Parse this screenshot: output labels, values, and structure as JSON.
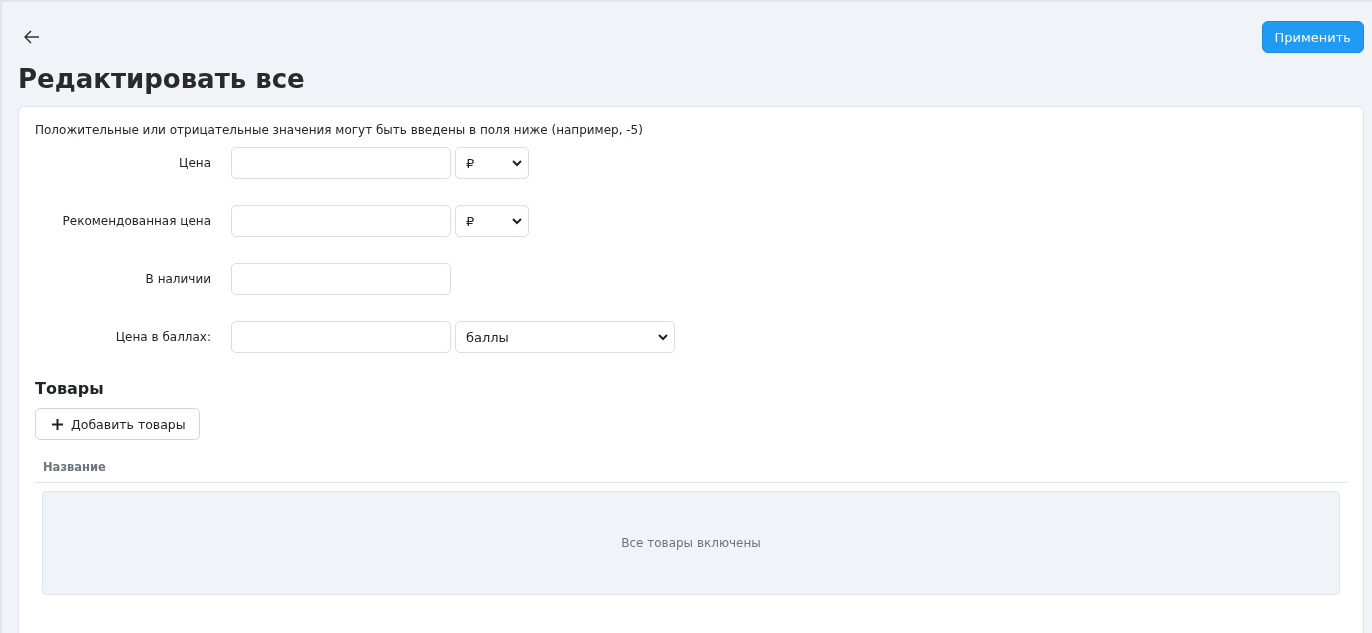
{
  "header": {
    "apply_button": "Применить"
  },
  "title": "Редактировать все",
  "hint": "Положительные или отрицательные значения могут быть введены в поля ниже (например, -5)",
  "fields": [
    {
      "label": "Цена",
      "kind": "unit",
      "unit": "₽"
    },
    {
      "label": "Рекомендованная цена",
      "kind": "unit",
      "unit": "₽"
    },
    {
      "label": "В наличии",
      "kind": "plain"
    },
    {
      "label": "Цена в баллах:",
      "kind": "wide",
      "unit": "баллы"
    }
  ],
  "products": {
    "title": "Товары",
    "add_button": "Добавить товары",
    "columns": [
      "Название"
    ],
    "empty_text": "Все товары включены"
  }
}
